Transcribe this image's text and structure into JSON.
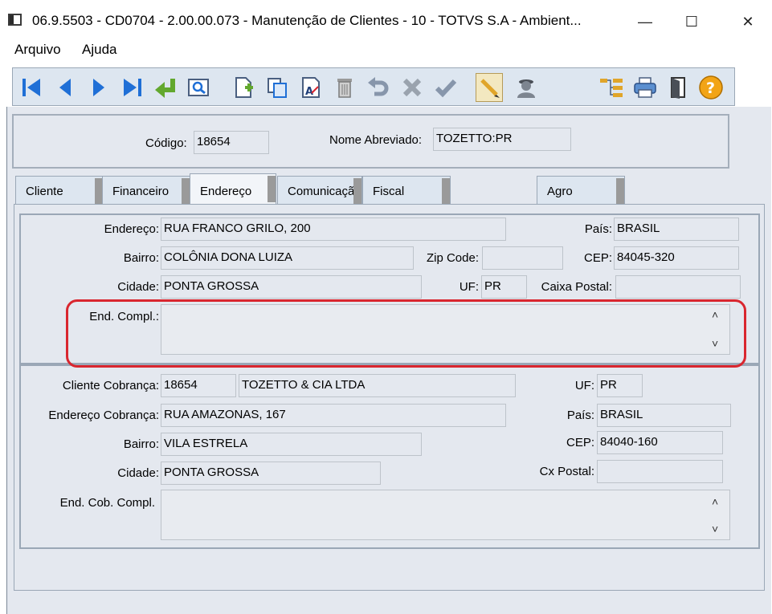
{
  "window": {
    "title": "06.9.5503 - CD0704 - 2.00.00.073 - Manutenção de Clientes - 10 - TOTVS S.A - Ambient...",
    "minimize": "—",
    "maximize": "☐",
    "close": "✕"
  },
  "menu": {
    "items": [
      "Arquivo",
      "Ajuda"
    ]
  },
  "header": {
    "codigo_label": "Código:",
    "codigo_value": "18654",
    "nome_label": "Nome Abreviado:",
    "nome_value": "TOZETTO:PR"
  },
  "tabs": [
    "Cliente",
    "Financeiro",
    "Endereço",
    "Comunicaçã",
    "Fiscal",
    "Agro"
  ],
  "active_tab": "Endereço",
  "endereco": {
    "endereco_label": "Endereço:",
    "endereco_value": "RUA FRANCO GRILO, 200",
    "pais_label": "País:",
    "pais_value": "BRASIL",
    "bairro_label": "Bairro:",
    "bairro_value": "COLÔNIA DONA LUIZA",
    "zip_label": "Zip Code:",
    "zip_value": "",
    "cep_label": "CEP:",
    "cep_value": "84045-320",
    "cidade_label": "Cidade:",
    "cidade_value": "PONTA GROSSA",
    "uf_label": "UF:",
    "uf_value": "PR",
    "caixa_label": "Caixa Postal:",
    "caixa_value": "",
    "compl_label": "End. Compl.:",
    "compl_value": ""
  },
  "cobranca": {
    "cliente_label": "Cliente Cobrança:",
    "cliente_codigo": "18654",
    "cliente_nome": "TOZETTO & CIA LTDA",
    "uf_label": "UF:",
    "uf_value": "PR",
    "endereco_label": "Endereço Cobrança:",
    "endereco_value": "RUA AMAZONAS, 167",
    "pais_label": "País:",
    "pais_value": "BRASIL",
    "bairro_label": "Bairro:",
    "bairro_value": "VILA ESTRELA",
    "cep_label": "CEP:",
    "cep_value": "84040-160",
    "cidade_label": "Cidade:",
    "cidade_value": "PONTA GROSSA",
    "cxpostal_label": "Cx Postal:",
    "cxpostal_value": "",
    "compl_label": "End. Cob. Compl.",
    "compl_value": ""
  },
  "scroll": {
    "up": "˄",
    "down": "˅"
  },
  "colors": {
    "highlight": "#d9262f",
    "nav_blue": "#1f6fd6",
    "panel": "#e4e8ef"
  }
}
